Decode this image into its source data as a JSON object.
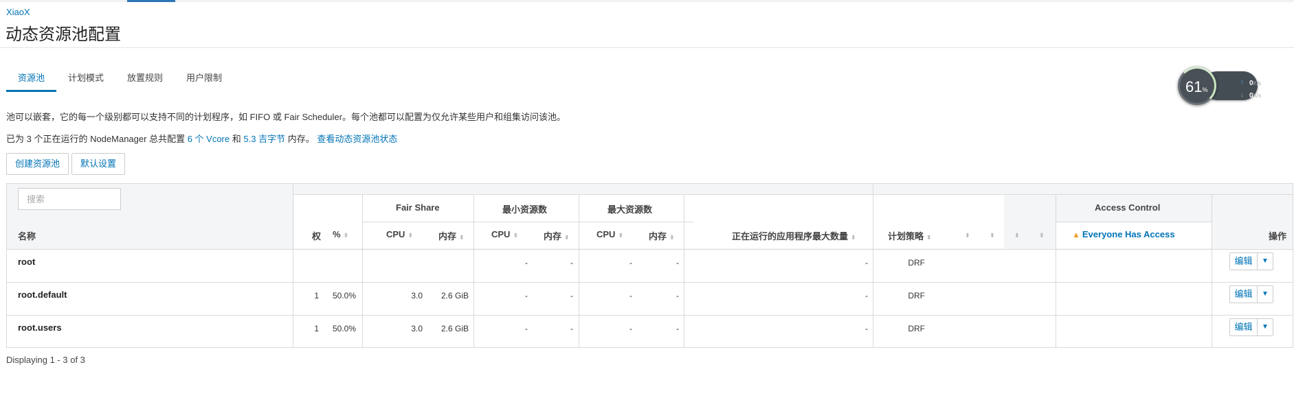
{
  "cluster_name": "XiaoX",
  "page_title": "动态资源池配置",
  "tabs": [
    {
      "label": "资源池"
    },
    {
      "label": "计划模式"
    },
    {
      "label": "放置规则"
    },
    {
      "label": "用户限制"
    }
  ],
  "description": "池可以嵌套，它的每一个级别都可以支持不同的计划程序，如 FIFO 或 Fair Scheduler。每个池都可以配置为仅允许某些用户和组集访问该池。",
  "summary": {
    "prefix": "已为 3 个正在运行的 NodeManager 总共配置",
    "vcore": "6 个 Vcore",
    "and": "和",
    "memory": "5.3 吉字节",
    "suffix": "内存。",
    "status_link": "查看动态资源池状态"
  },
  "buttons": {
    "create": "创建资源池",
    "defaults": "默认设置"
  },
  "widget": {
    "percent": "61",
    "percent_unit": "%",
    "up": "0",
    "down": "0",
    "unit": "K/s"
  },
  "table": {
    "search_placeholder": "搜索",
    "headers": {
      "name": "名称",
      "weight": "权",
      "percent": "%",
      "fair_share": "Fair Share",
      "min_resources": "最小资源数",
      "max_resources": "最大资源数",
      "cpu": "CPU",
      "memory": "内存",
      "max_running_apps": "正在运行的应用程序最大数量",
      "schedule_policy": "计划策略",
      "access_control": "Access Control",
      "everyone_access": "Everyone Has Access",
      "actions": "操作"
    },
    "rows": [
      {
        "name": "root",
        "weight": "",
        "percent": "",
        "fs_cpu": "",
        "fs_mem": "",
        "min_cpu": "-",
        "min_mem": "-",
        "max_cpu": "-",
        "max_mem": "-",
        "max_apps": "-",
        "policy": "DRF",
        "edit": "编辑"
      },
      {
        "name": "root.default",
        "weight": "1",
        "percent": "50.0%",
        "fs_cpu": "3.0",
        "fs_mem": "2.6 GiB",
        "min_cpu": "-",
        "min_mem": "-",
        "max_cpu": "-",
        "max_mem": "-",
        "max_apps": "-",
        "policy": "DRF",
        "edit": "编辑"
      },
      {
        "name": "root.users",
        "weight": "1",
        "percent": "50.0%",
        "fs_cpu": "3.0",
        "fs_mem": "2.6 GiB",
        "min_cpu": "-",
        "min_mem": "-",
        "max_cpu": "-",
        "max_mem": "-",
        "max_apps": "-",
        "policy": "DRF",
        "edit": "编辑"
      }
    ]
  },
  "footer": "Displaying 1 - 3 of 3"
}
